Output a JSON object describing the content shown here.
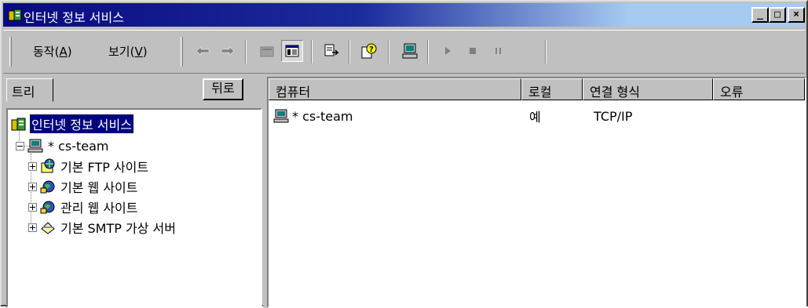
{
  "window": {
    "title": "인터넷 정보 서비스",
    "min_label": "_",
    "max_label": "□",
    "close_label": "×"
  },
  "toolbar": {
    "action_menu": {
      "label": "동작(",
      "accel": "A",
      "suffix": ")"
    },
    "view_menu": {
      "label": "보기(",
      "accel": "V",
      "suffix": ")"
    },
    "icons": [
      "back-arrow-icon",
      "forward-arrow-icon",
      "up-folder-icon",
      "show-hide-tree-icon",
      "export-list-icon",
      "help-icon",
      "computer-icon",
      "play-icon",
      "stop-icon",
      "pause-icon"
    ]
  },
  "tree_pane": {
    "tab_label": "트리",
    "back_label": "뒤로",
    "items": [
      {
        "label": "인터넷 정보 서비스",
        "icon": "iis-icon",
        "selected": true
      },
      {
        "label": "* cs-team",
        "icon": "computer-icon"
      },
      {
        "label": "기본 FTP 사이트",
        "icon": "ftp-site-icon"
      },
      {
        "label": "기본 웹 사이트",
        "icon": "web-site-icon"
      },
      {
        "label": "관리 웹 사이트",
        "icon": "web-site-icon"
      },
      {
        "label": "기본 SMTP 가상 서버",
        "icon": "smtp-server-icon"
      }
    ]
  },
  "list_pane": {
    "columns": [
      "컴퓨터",
      "로컬",
      "연결 형식",
      "오류"
    ],
    "rows": [
      {
        "computer": "* cs-team",
        "local": "예",
        "connection": "TCP/IP",
        "error": ""
      }
    ]
  },
  "colors": {
    "titlebar_start": "#0a0a80",
    "titlebar_end": "#a6caf0",
    "selection": "#000080",
    "face": "#c0c0c0"
  }
}
